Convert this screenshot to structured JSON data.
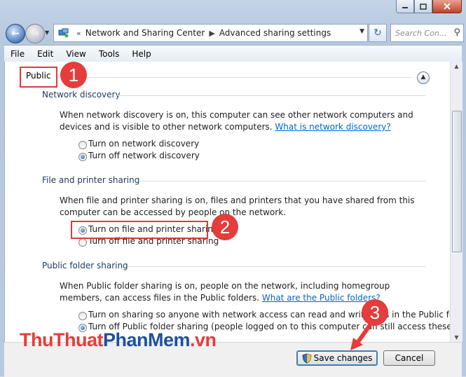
{
  "window": {
    "caption_buttons": [
      "minimize-icon",
      "maximize-icon",
      "close-icon"
    ]
  },
  "address": {
    "overflow": "«",
    "crumb1": "Network and Sharing Center",
    "separator": "▶",
    "crumb2": "Advanced sharing settings",
    "search_placeholder": "Search Con..."
  },
  "menu": {
    "items": [
      "File",
      "Edit",
      "View",
      "Tools",
      "Help"
    ]
  },
  "profile": {
    "title": "Public"
  },
  "sections": {
    "discovery": {
      "header": "Network discovery",
      "desc": "When network discovery is on, this computer can see other network computers and devices and is visible to other network computers.",
      "link": "What is network discovery?",
      "opt_on": "Turn on network discovery",
      "opt_off": "Turn off network discovery",
      "selected": "off"
    },
    "fileprint": {
      "header": "File and printer sharing",
      "desc": "When file and printer sharing is on, files and printers that you have shared from this computer can be accessed by people on the network.",
      "opt_on": "Turn on file and printer sharing",
      "opt_off": "Turn off file and printer sharing",
      "selected": "on"
    },
    "publicfolder": {
      "header": "Public folder sharing",
      "desc": "When Public folder sharing is on, people on the network, including homegroup members, can access files in the Public folders.",
      "link": "What are the Public folders?",
      "opt_on": "Turn on sharing so anyone with network access can read and write files in the Public folders",
      "opt_off": "Turn off Public folder sharing (people logged on to this computer can still access these",
      "selected": "off"
    }
  },
  "buttons": {
    "save": "Save changes",
    "cancel": "Cancel"
  },
  "annotations": {
    "step1": "1",
    "step2": "2",
    "step3": "3",
    "highlight_color": "#e03b36"
  },
  "watermark": {
    "part1": "ThuThuat",
    "part2": "PhanMem",
    "part3": ".vn"
  }
}
